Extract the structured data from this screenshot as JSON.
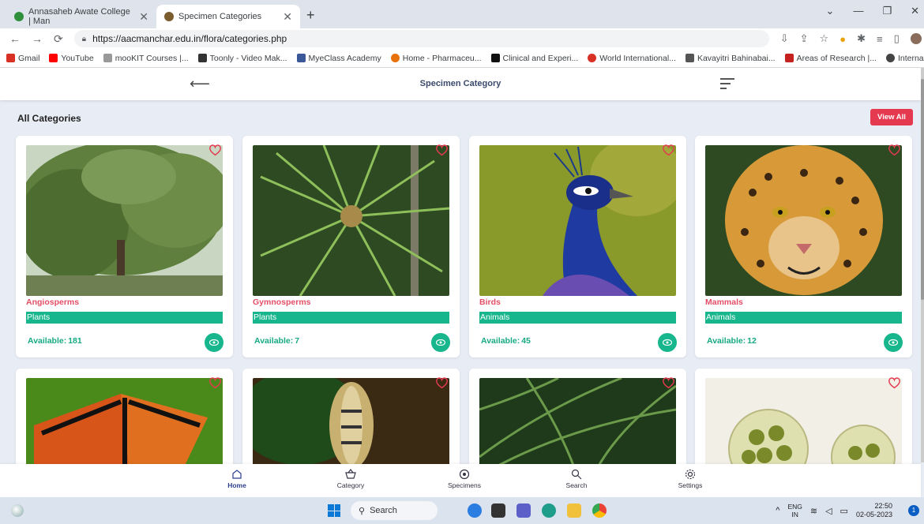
{
  "browser": {
    "tabs": [
      {
        "title": "Annasaheb Awate College | Man",
        "favicon_color": "#2f8f3a"
      },
      {
        "title": "Specimen Categories",
        "favicon_color": "#7a5c2e"
      }
    ],
    "url": "https://aacmanchar.edu.in/flora/categories.php",
    "bookmarks": [
      {
        "label": "Gmail",
        "color": "#d93025"
      },
      {
        "label": "YouTube",
        "color": "#ff0000"
      },
      {
        "label": "mooKIT Courses |...",
        "color": "#999999"
      },
      {
        "label": "Toonly - Video Mak...",
        "color": "#333333"
      },
      {
        "label": "MyeClass Academy",
        "color": "#3b5998"
      },
      {
        "label": "Home - Pharmaceu...",
        "color": "#e8710a"
      },
      {
        "label": "Clinical and Experi...",
        "color": "#111111"
      },
      {
        "label": "World International...",
        "color": "#d93025"
      },
      {
        "label": "Kavayitri Bahinabai...",
        "color": "#555555"
      },
      {
        "label": "Areas of Research |...",
        "color": "#c5221f"
      },
      {
        "label": "International Food...",
        "color": "#444444"
      }
    ],
    "more_bookmarks": "»"
  },
  "header": {
    "title": "Specimen Category"
  },
  "section": {
    "title": "All Categories",
    "view_all_label": "View All"
  },
  "cards": [
    {
      "name": "Angiosperms",
      "group": "Plants",
      "available_label": "Available:",
      "available": "181"
    },
    {
      "name": "Gymnosperms",
      "group": "Plants",
      "available_label": "Available:",
      "available": "7"
    },
    {
      "name": "Birds",
      "group": "Animals",
      "available_label": "Available:",
      "available": "45"
    },
    {
      "name": "Mammals",
      "group": "Animals",
      "available_label": "Available:",
      "available": "12"
    }
  ],
  "bottom_nav": [
    {
      "label": "Home",
      "icon": "home-icon",
      "active": true
    },
    {
      "label": "Category",
      "icon": "basket-icon",
      "active": false
    },
    {
      "label": "Specimens",
      "icon": "specimen-icon",
      "active": false
    },
    {
      "label": "Search",
      "icon": "search-icon",
      "active": false
    },
    {
      "label": "Settings",
      "icon": "gear-icon",
      "active": false
    }
  ],
  "taskbar": {
    "search_placeholder": "Search",
    "lang_top": "ENG",
    "lang_bottom": "IN",
    "time": "22:50",
    "date": "02-05-2023",
    "notification_count": "1"
  },
  "colors": {
    "accent_green": "#18b68c",
    "accent_red": "#e53950",
    "category_name": "#e34e66"
  }
}
